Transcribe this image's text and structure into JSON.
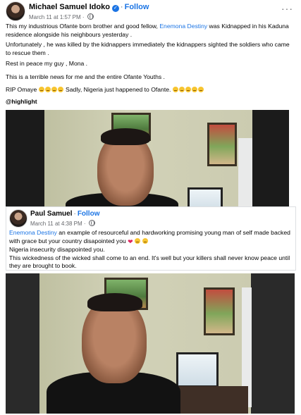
{
  "post1": {
    "author": "Michael Samuel Idoko",
    "follow_label": "Follow",
    "time": "March 11 at 1:57 PM",
    "more": "···",
    "p1_a": "This my industrious Ofante born brother and good fellow, ",
    "p1_mention": "Enemona Destiny",
    "p1_b": " was Kidnapped in his Kaduna residence alongside his neighbours yesterday .",
    "p2": "Unfortunately , he was  killed by the kidnappers immediately the kidnappers sighted the soldiers who came to rescue  them .",
    "p3": "Rest in peace my guy , Mona .",
    "p4": "This is a terrible news for me and the entire Ofante Youths .",
    "p5_a": "RIP Omaye ",
    "p5_b": " Sadly,  Nigeria just happened to Ofante. ",
    "p6": "@highlight"
  },
  "post2": {
    "author": "Paul Samuel",
    "follow_label": "Follow",
    "time": "March 11 at 4:38 PM",
    "l1_mention": "Enemona Destiny",
    "l1_rest": " an example of resourceful and hardworking promising young man of self made backed with grace but your country disapointed you ",
    "l2": "Nigeria insecurity disappointed you.",
    "l3": "This wickedness of the wicked shall come to an end. It's well but your killers shall never know peace until they are brought to book."
  },
  "colors": {
    "link_blue": "#1b74e4",
    "meta_gray": "#65676b"
  },
  "icons": [
    "verified-badge-icon",
    "globe-icon",
    "more-options-icon",
    "crying-emoji-icon",
    "broken-heart-icon"
  ]
}
